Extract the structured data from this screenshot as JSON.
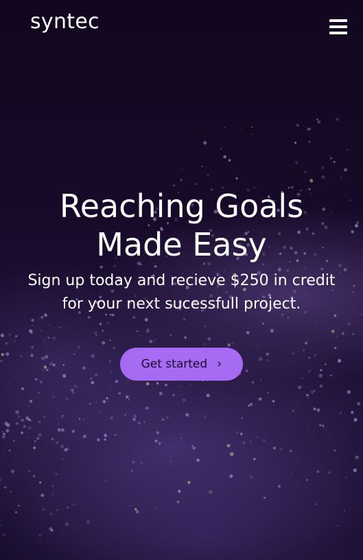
{
  "header": {
    "logo": "syntec",
    "menu_icon": "hamburger-menu-icon"
  },
  "hero": {
    "headline_line1": "Reaching Goals",
    "headline_line2": "Made Easy",
    "subline_line1": "Sign up today and recieve $250 in credit",
    "subline_line2": "for your next sucessfull project.",
    "cta_label": "Get started",
    "cta_icon": "chevron-right-icon"
  },
  "colors": {
    "background": "#12061f",
    "accent": "#a66bf2",
    "text": "#ffffff"
  }
}
